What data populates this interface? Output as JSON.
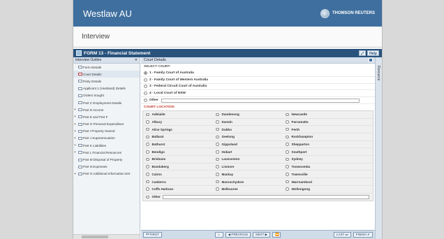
{
  "app": {
    "brand": "Westlaw AU",
    "vendor": "THOMSON REUTERS",
    "page_title": "Interview"
  },
  "form": {
    "title": "FORM 13 - Financial Statement",
    "help_label": "Help"
  },
  "outline": {
    "header": "Interview Outline",
    "close_glyph": "✕",
    "items": [
      {
        "label": "Form Details",
        "expandable": false,
        "selected": false
      },
      {
        "label": "Court Details",
        "expandable": false,
        "selected": true
      },
      {
        "label": "Party Details",
        "expandable": false,
        "selected": false
      },
      {
        "label": "Applicant 1 (Husband) Details",
        "expandable": false,
        "selected": false
      },
      {
        "label": "Orders Sought",
        "expandable": false,
        "selected": false
      },
      {
        "label": "Part C Employment Details",
        "expandable": false,
        "selected": false
      },
      {
        "label": "Part D Income",
        "expandable": true,
        "selected": false
      },
      {
        "label": "Part E and Part F",
        "expandable": true,
        "selected": false
      },
      {
        "label": "Part G Personal Expenditure",
        "expandable": true,
        "selected": false
      },
      {
        "label": "Part I Property Owned",
        "expandable": true,
        "selected": false
      },
      {
        "label": "Part J Superannuation",
        "expandable": true,
        "selected": false
      },
      {
        "label": "Part K Liabilities",
        "expandable": true,
        "selected": false
      },
      {
        "label": "Part L Financial Resources",
        "expandable": true,
        "selected": false
      },
      {
        "label": "Part M Disposal of Property",
        "expandable": false,
        "selected": false
      },
      {
        "label": "Part N Expenses",
        "expandable": false,
        "selected": false
      },
      {
        "label": "Part O Additional Information Det",
        "expandable": true,
        "selected": false
      }
    ]
  },
  "court_details": {
    "header": "Court Details",
    "select_court_label": "SELECT COURT:",
    "courts": [
      {
        "label": "1 - Family Court of Australia",
        "selected": true
      },
      {
        "label": "2 - Family Court of Western Australia",
        "selected": false
      },
      {
        "label": "3 - Federal Circuit Court of Australia",
        "selected": false
      },
      {
        "label": "4 - Local Court of NSW",
        "selected": false
      }
    ],
    "other_label": "Other",
    "other_value": "",
    "location_label": "COURT LOCATION:",
    "locations": [
      [
        "Adelaide",
        "Dandenong",
        "Newcastle"
      ],
      [
        "Albury",
        "Darwin",
        "Parramatta"
      ],
      [
        "Alice Springs",
        "Dubbo",
        "Perth"
      ],
      [
        "Ballarat",
        "Geelong",
        "Rockhampton"
      ],
      [
        "Bathurst",
        "Gippsland",
        "Shepparton"
      ],
      [
        "Bendigo",
        "Hobart",
        "Southport"
      ],
      [
        "Brisbane",
        "Launceston",
        "Sydney"
      ],
      [
        "Bundaberg",
        "Lismore",
        "Toowoomba"
      ],
      [
        "Cairns",
        "Mackay",
        "Townsville"
      ],
      [
        "Canberra",
        "Maroochydore",
        "Warrnambool"
      ],
      [
        "Coffs Harbour",
        "Melbourne",
        "Wollongong"
      ]
    ],
    "location_other_label": "Other",
    "location_other_value": ""
  },
  "side_panel": {
    "label": "Resource"
  },
  "nav": {
    "first": "FIRST",
    "previous": "PREVIOUS",
    "next": "NEXT",
    "last": "LAST",
    "finish": "FINISH"
  }
}
